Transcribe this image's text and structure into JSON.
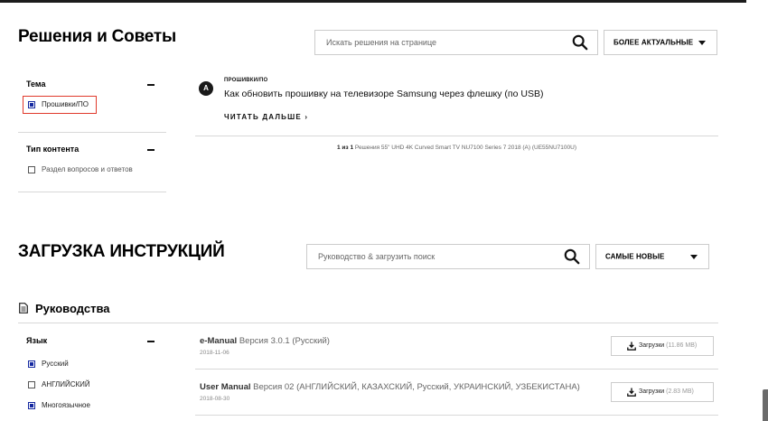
{
  "solutions": {
    "title": "Решения и Советы",
    "search_placeholder": "Искать решения на странице",
    "sort_label": "БОЛЕЕ АКТУАЛЬНЫЕ",
    "filters": {
      "topic": {
        "heading": "Тема",
        "options": [
          {
            "label": "Прошивки/ПО",
            "checked": true
          }
        ]
      },
      "content_type": {
        "heading": "Тип контента",
        "options": [
          {
            "label": "Раздел вопросов и ответов",
            "checked": false
          }
        ]
      }
    },
    "article": {
      "icon_letter": "A",
      "category": "ПРОШИВКИ/ПО",
      "title": "Как обновить прошивку на телевизоре Samsung через флешку (по USB)",
      "read_more": "ЧИТАТЬ ДАЛЬШЕ ›"
    },
    "results": {
      "count": "1 из 1",
      "text": "Решения 55\" UHD 4K Curved Smart TV NU7100 Series 7 2018 (A) (UE55NU7100U)"
    }
  },
  "downloads": {
    "title": "ЗАГРУЗКА ИНСТРУКЦИЙ",
    "search_placeholder": "Руководство & загрузить поиск",
    "sort_label": "САМЫЕ НОВЫЕ",
    "section_title": "Руководства",
    "language_filter": {
      "heading": "Язык",
      "options": [
        {
          "label": "Русский",
          "checked": true
        },
        {
          "label": "АНГЛИЙСКИЙ",
          "checked": false
        },
        {
          "label": "Многоязычное",
          "checked": true
        }
      ]
    },
    "manuals": [
      {
        "name": "e-Manual",
        "version": "Версия 3.0.1 (Русский)",
        "date": "2018-11-06",
        "button": "Загрузки",
        "size": "(11.86 MB)"
      },
      {
        "name": "User Manual",
        "version": "Версия 02 (АНГЛИЙСКИЙ, КАЗАХСКИЙ, Русский, УКРАИНСКИЙ, УЗБЕКИСТАНА)",
        "date": "2018-08-30",
        "button": "Загрузки",
        "size": "(2.83 MB)"
      }
    ]
  },
  "colors": {
    "accent": "#1428a0",
    "highlight": "#e0392b"
  }
}
